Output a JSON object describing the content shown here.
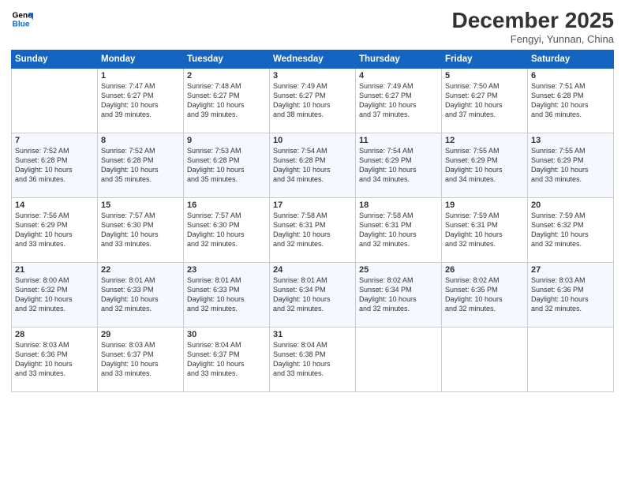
{
  "header": {
    "logo_line1": "General",
    "logo_line2": "Blue",
    "month_title": "December 2025",
    "location": "Fengyi, Yunnan, China"
  },
  "days_of_week": [
    "Sunday",
    "Monday",
    "Tuesday",
    "Wednesday",
    "Thursday",
    "Friday",
    "Saturday"
  ],
  "weeks": [
    [
      {
        "num": "",
        "info": ""
      },
      {
        "num": "1",
        "info": "Sunrise: 7:47 AM\nSunset: 6:27 PM\nDaylight: 10 hours\nand 39 minutes."
      },
      {
        "num": "2",
        "info": "Sunrise: 7:48 AM\nSunset: 6:27 PM\nDaylight: 10 hours\nand 39 minutes."
      },
      {
        "num": "3",
        "info": "Sunrise: 7:49 AM\nSunset: 6:27 PM\nDaylight: 10 hours\nand 38 minutes."
      },
      {
        "num": "4",
        "info": "Sunrise: 7:49 AM\nSunset: 6:27 PM\nDaylight: 10 hours\nand 37 minutes."
      },
      {
        "num": "5",
        "info": "Sunrise: 7:50 AM\nSunset: 6:27 PM\nDaylight: 10 hours\nand 37 minutes."
      },
      {
        "num": "6",
        "info": "Sunrise: 7:51 AM\nSunset: 6:28 PM\nDaylight: 10 hours\nand 36 minutes."
      }
    ],
    [
      {
        "num": "7",
        "info": "Sunrise: 7:52 AM\nSunset: 6:28 PM\nDaylight: 10 hours\nand 36 minutes."
      },
      {
        "num": "8",
        "info": "Sunrise: 7:52 AM\nSunset: 6:28 PM\nDaylight: 10 hours\nand 35 minutes."
      },
      {
        "num": "9",
        "info": "Sunrise: 7:53 AM\nSunset: 6:28 PM\nDaylight: 10 hours\nand 35 minutes."
      },
      {
        "num": "10",
        "info": "Sunrise: 7:54 AM\nSunset: 6:28 PM\nDaylight: 10 hours\nand 34 minutes."
      },
      {
        "num": "11",
        "info": "Sunrise: 7:54 AM\nSunset: 6:29 PM\nDaylight: 10 hours\nand 34 minutes."
      },
      {
        "num": "12",
        "info": "Sunrise: 7:55 AM\nSunset: 6:29 PM\nDaylight: 10 hours\nand 34 minutes."
      },
      {
        "num": "13",
        "info": "Sunrise: 7:55 AM\nSunset: 6:29 PM\nDaylight: 10 hours\nand 33 minutes."
      }
    ],
    [
      {
        "num": "14",
        "info": "Sunrise: 7:56 AM\nSunset: 6:29 PM\nDaylight: 10 hours\nand 33 minutes."
      },
      {
        "num": "15",
        "info": "Sunrise: 7:57 AM\nSunset: 6:30 PM\nDaylight: 10 hours\nand 33 minutes."
      },
      {
        "num": "16",
        "info": "Sunrise: 7:57 AM\nSunset: 6:30 PM\nDaylight: 10 hours\nand 32 minutes."
      },
      {
        "num": "17",
        "info": "Sunrise: 7:58 AM\nSunset: 6:31 PM\nDaylight: 10 hours\nand 32 minutes."
      },
      {
        "num": "18",
        "info": "Sunrise: 7:58 AM\nSunset: 6:31 PM\nDaylight: 10 hours\nand 32 minutes."
      },
      {
        "num": "19",
        "info": "Sunrise: 7:59 AM\nSunset: 6:31 PM\nDaylight: 10 hours\nand 32 minutes."
      },
      {
        "num": "20",
        "info": "Sunrise: 7:59 AM\nSunset: 6:32 PM\nDaylight: 10 hours\nand 32 minutes."
      }
    ],
    [
      {
        "num": "21",
        "info": "Sunrise: 8:00 AM\nSunset: 6:32 PM\nDaylight: 10 hours\nand 32 minutes."
      },
      {
        "num": "22",
        "info": "Sunrise: 8:01 AM\nSunset: 6:33 PM\nDaylight: 10 hours\nand 32 minutes."
      },
      {
        "num": "23",
        "info": "Sunrise: 8:01 AM\nSunset: 6:33 PM\nDaylight: 10 hours\nand 32 minutes."
      },
      {
        "num": "24",
        "info": "Sunrise: 8:01 AM\nSunset: 6:34 PM\nDaylight: 10 hours\nand 32 minutes."
      },
      {
        "num": "25",
        "info": "Sunrise: 8:02 AM\nSunset: 6:34 PM\nDaylight: 10 hours\nand 32 minutes."
      },
      {
        "num": "26",
        "info": "Sunrise: 8:02 AM\nSunset: 6:35 PM\nDaylight: 10 hours\nand 32 minutes."
      },
      {
        "num": "27",
        "info": "Sunrise: 8:03 AM\nSunset: 6:36 PM\nDaylight: 10 hours\nand 32 minutes."
      }
    ],
    [
      {
        "num": "28",
        "info": "Sunrise: 8:03 AM\nSunset: 6:36 PM\nDaylight: 10 hours\nand 33 minutes."
      },
      {
        "num": "29",
        "info": "Sunrise: 8:03 AM\nSunset: 6:37 PM\nDaylight: 10 hours\nand 33 minutes."
      },
      {
        "num": "30",
        "info": "Sunrise: 8:04 AM\nSunset: 6:37 PM\nDaylight: 10 hours\nand 33 minutes."
      },
      {
        "num": "31",
        "info": "Sunrise: 8:04 AM\nSunset: 6:38 PM\nDaylight: 10 hours\nand 33 minutes."
      },
      {
        "num": "",
        "info": ""
      },
      {
        "num": "",
        "info": ""
      },
      {
        "num": "",
        "info": ""
      }
    ]
  ]
}
